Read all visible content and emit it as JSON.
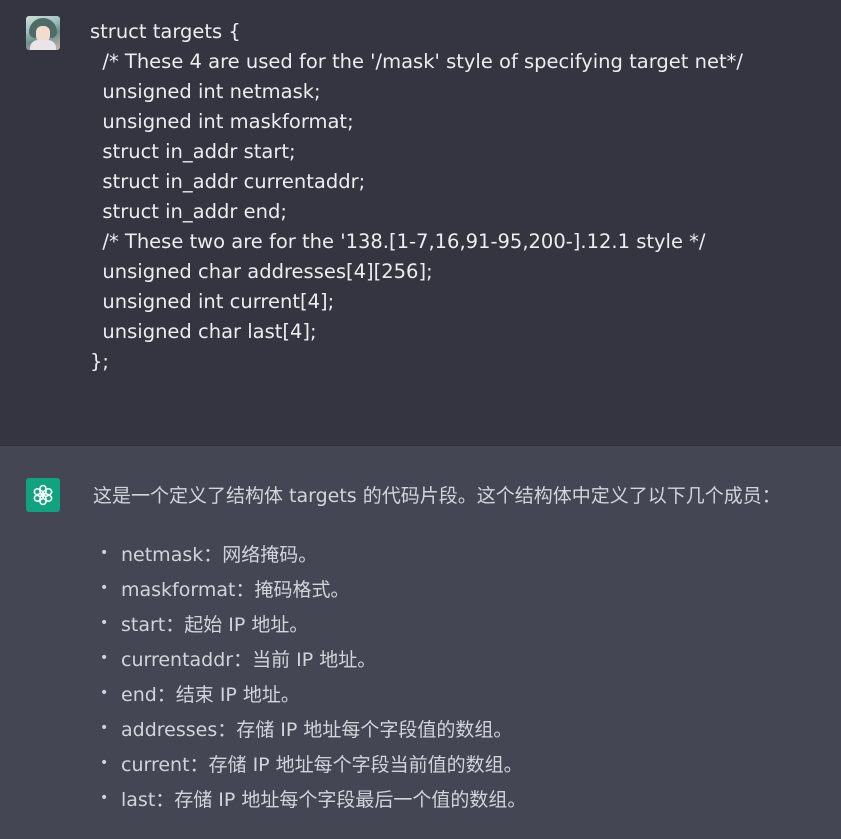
{
  "user_message": {
    "avatar": "user-avatar",
    "code_lines": [
      "struct targets {",
      "  /* These 4 are used for the '/mask' style of specifying target net*/",
      "  unsigned int netmask;",
      "  unsigned int maskformat;",
      "  struct in_addr start;",
      "  struct in_addr currentaddr;",
      "  struct in_addr end;",
      "  /* These two are for the '138.[1-7,16,91-95,200-].12.1 style */",
      "  unsigned char addresses[4][256];",
      "  unsigned int current[4];",
      "  unsigned char last[4];",
      "};"
    ]
  },
  "assistant_message": {
    "avatar": "openai-logo-icon",
    "intro": "这是一个定义了结构体 targets 的代码片段。这个结构体中定义了以下几个成员：",
    "members": [
      "netmask：网络掩码。",
      "maskformat：掩码格式。",
      "start：起始 IP 地址。",
      "currentaddr：当前 IP 地址。",
      "end：结束 IP 地址。",
      "addresses：存储 IP 地址每个字段值的数组。",
      "current：存储 IP 地址每个字段当前值的数组。",
      "last：存储 IP 地址每个字段最后一个值的数组。"
    ]
  },
  "colors": {
    "user_bg": "#343541",
    "assistant_bg": "#444654",
    "text": "#ececf1",
    "gpt_green": "#10a37f"
  }
}
